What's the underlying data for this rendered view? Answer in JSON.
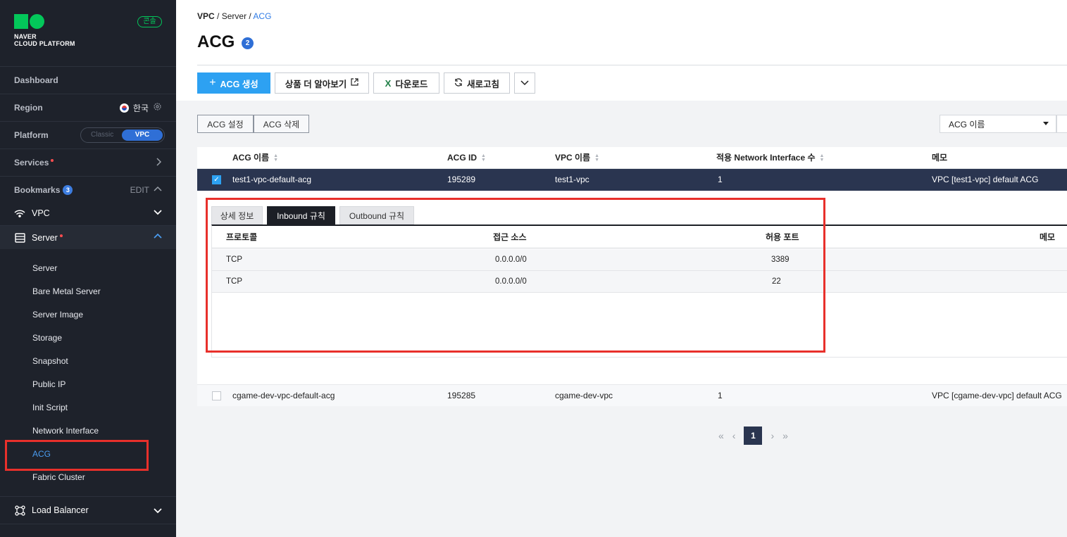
{
  "logo": {
    "line1": "NAVER",
    "line2": "CLOUD PLATFORM"
  },
  "console_badge": "콘솔",
  "sidebar": {
    "dashboard": "Dashboard",
    "region": {
      "label": "Region",
      "value": "한국"
    },
    "platform": {
      "label": "Platform",
      "off": "Classic",
      "on": "VPC"
    },
    "services": "Services",
    "bookmarks": {
      "label": "Bookmarks",
      "count": "3",
      "edit": "EDIT"
    },
    "menu": {
      "vpc": "VPC",
      "server": "Server",
      "load_balancer": "Load Balancer"
    },
    "server_items": [
      "Server",
      "Bare Metal Server",
      "Server Image",
      "Storage",
      "Snapshot",
      "Public IP",
      "Init Script",
      "Network Interface",
      "ACG",
      "Fabric Cluster"
    ]
  },
  "breadcrumb": {
    "a": "VPC",
    "b": "Server",
    "c": "ACG",
    "sep": "/"
  },
  "page": {
    "title": "ACG",
    "count": "2"
  },
  "toolbar": {
    "create": "ACG 생성",
    "learn": "상품 더 알아보기",
    "download": "다운로드",
    "refresh": "새로고침"
  },
  "actions": {
    "settings": "ACG 설정",
    "delete": "ACG 삭제"
  },
  "filter": {
    "selected": "ACG 이름"
  },
  "table": {
    "headers": [
      "ACG 이름",
      "ACG ID",
      "VPC 이름",
      "적용 Network Interface 수",
      "메모"
    ],
    "rows": [
      {
        "name": "test1-vpc-default-acg",
        "id": "195289",
        "vpc": "test1-vpc",
        "count": "1",
        "memo": "VPC [test1-vpc] default ACG",
        "selected": true
      },
      {
        "name": "cgame-dev-vpc-default-acg",
        "id": "195285",
        "vpc": "cgame-dev-vpc",
        "count": "1",
        "memo": "VPC [cgame-dev-vpc] default ACG",
        "selected": false
      }
    ]
  },
  "detail": {
    "tabs": [
      "상세 정보",
      "Inbound 규칙",
      "Outbound 규칙"
    ],
    "active_tab": "Inbound 규칙",
    "headers": [
      "프로토콜",
      "접근 소스",
      "허용 포트",
      "메모"
    ],
    "rules": [
      {
        "protocol": "TCP",
        "source": "0.0.0.0/0",
        "port": "3389"
      },
      {
        "protocol": "TCP",
        "source": "0.0.0.0/0",
        "port": "22"
      }
    ]
  },
  "pagination": {
    "current": "1"
  },
  "colors": {
    "highlight_box": "#e8302b",
    "primary": "#2da1f2",
    "selected_row": "#2a3550",
    "sidebar_bg": "#1e222b"
  }
}
